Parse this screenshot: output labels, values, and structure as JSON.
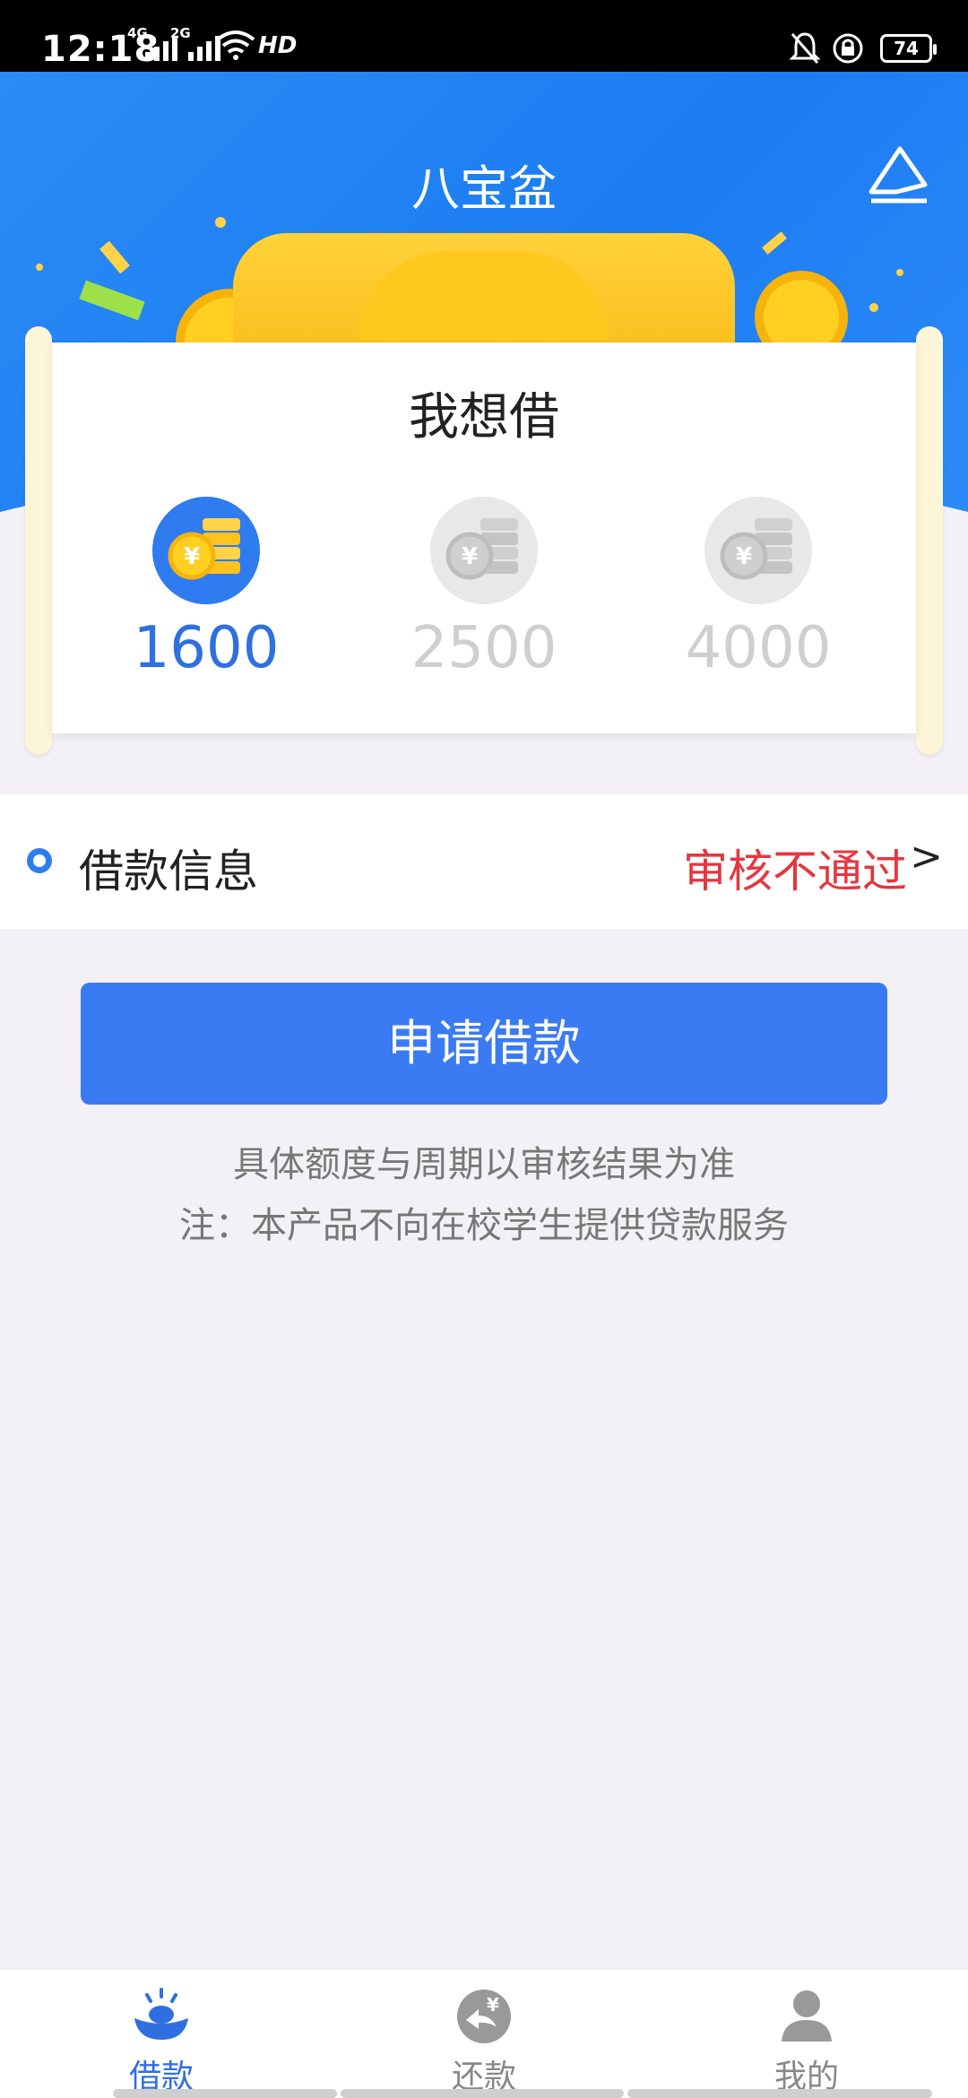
{
  "status_bar": {
    "time": "12:18",
    "sim1": "4G",
    "sim2": "2G",
    "hd": "HD",
    "battery": "74"
  },
  "header": {
    "title": "八宝盆"
  },
  "card": {
    "title": "我想借",
    "amounts": [
      {
        "value": "1600",
        "selected": true
      },
      {
        "value": "2500",
        "selected": false
      },
      {
        "value": "4000",
        "selected": false
      }
    ]
  },
  "loan_info": {
    "label": "借款信息",
    "status": "审核不通过",
    "arrow": ">"
  },
  "apply": {
    "label": "申请借款"
  },
  "notes": {
    "line1": "具体额度与周期以审核结果为准",
    "line2": "注：本产品不向在校学生提供贷款服务"
  },
  "tabs": [
    {
      "label": "借款",
      "active": true,
      "icon": "ingot-icon"
    },
    {
      "label": "还款",
      "active": false,
      "icon": "repay-icon"
    },
    {
      "label": "我的",
      "active": false,
      "icon": "profile-icon"
    }
  ],
  "colors": {
    "primary": "#3a7bf3",
    "status_fail": "#e6363f",
    "header_blue": "#1c7cf2"
  }
}
